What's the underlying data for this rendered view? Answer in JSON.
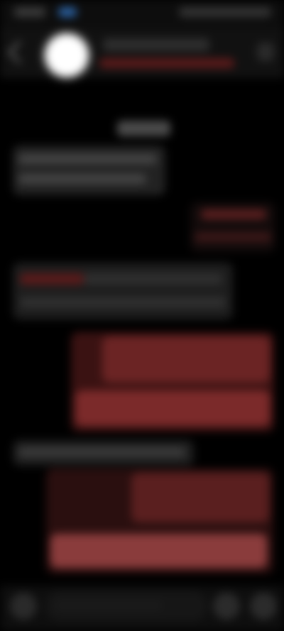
{
  "theme": {
    "background": "#000000",
    "incoming_bubble": "#222222",
    "outgoing_bubble": "#6b2424",
    "avatar": "#ffffff",
    "status_accent": "#2a5f9e"
  },
  "header": {
    "back_icon": "chevron-left-icon",
    "avatar_icon": "avatar",
    "menu_icon": "more-icon"
  },
  "composer": {
    "add_icon": "plus-icon",
    "mic_icon": "mic-icon",
    "send_icon": "send-icon"
  }
}
